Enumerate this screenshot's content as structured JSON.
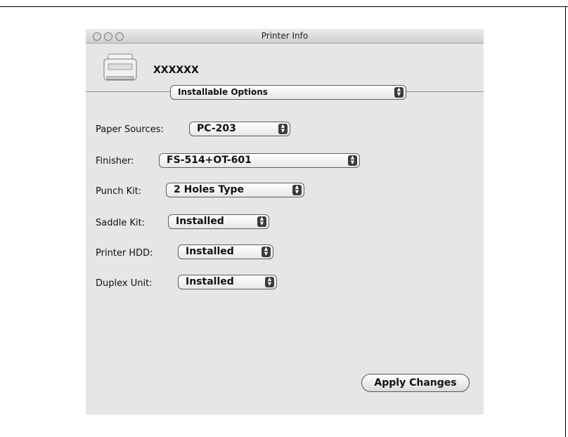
{
  "window": {
    "title": "Printer Info"
  },
  "printer": {
    "name": "XXXXXX"
  },
  "panel_selector": {
    "value": "Installable Options"
  },
  "options": [
    {
      "label": "Paper Sources:",
      "value": "PC-203"
    },
    {
      "label": "Finisher:",
      "value": "FS-514+OT-601"
    },
    {
      "label": "Punch Kit:",
      "value": "2 Holes Type"
    },
    {
      "label": "Saddle Kit:",
      "value": "Installed"
    },
    {
      "label": "Printer HDD:",
      "value": "Installed"
    },
    {
      "label": "Duplex Unit:",
      "value": "Installed"
    }
  ],
  "apply_button": {
    "label": "Apply Changes"
  },
  "icons": {
    "stepper": "up-down-arrows-icon",
    "printer": "printer-icon"
  }
}
